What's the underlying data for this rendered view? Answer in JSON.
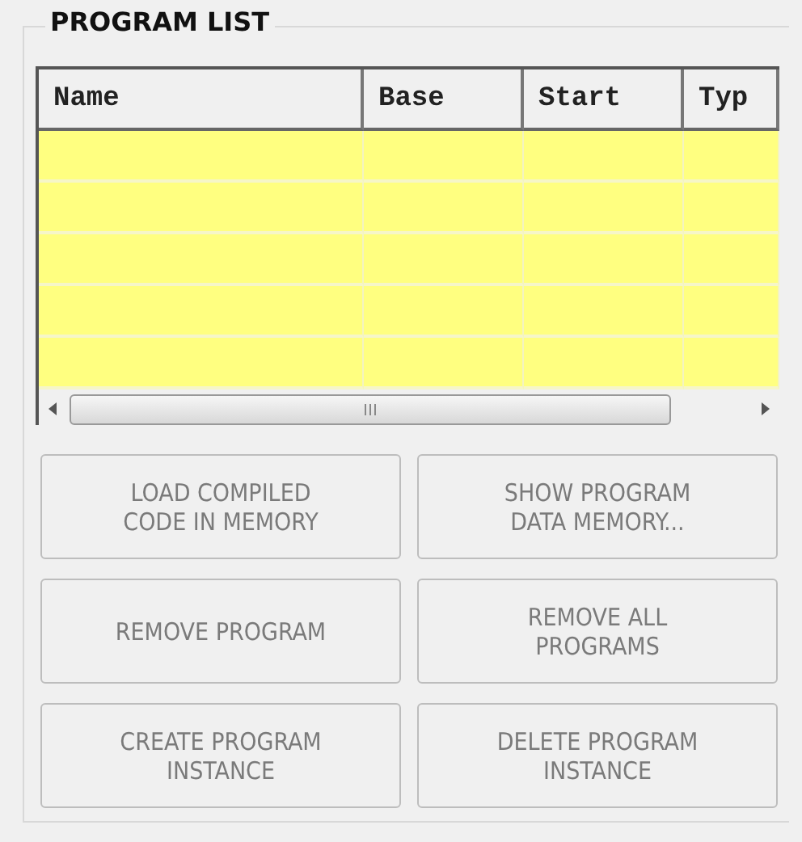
{
  "group": {
    "title": "PROGRAM LIST"
  },
  "table": {
    "columns": [
      {
        "label": "Name"
      },
      {
        "label": "Base"
      },
      {
        "label": "Start"
      },
      {
        "label": "Typ"
      }
    ]
  },
  "buttons": [
    {
      "label": "LOAD COMPILED\nCODE IN MEMORY",
      "disabled": true
    },
    {
      "label": "SHOW PROGRAM\nDATA MEMORY...",
      "disabled": true
    },
    {
      "label": "REMOVE PROGRAM",
      "disabled": true
    },
    {
      "label": "REMOVE ALL\nPROGRAMS",
      "disabled": true
    },
    {
      "label": "CREATE PROGRAM\nINSTANCE",
      "disabled": true
    },
    {
      "label": "DELETE PROGRAM\nINSTANCE",
      "disabled": true
    }
  ]
}
